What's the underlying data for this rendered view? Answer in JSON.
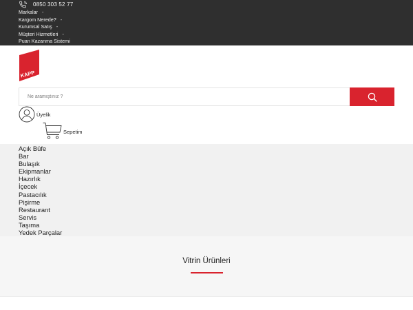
{
  "topbar": {
    "phone": "0850 303 52 77",
    "links": [
      {
        "label": "Markalar",
        "sep": "-"
      },
      {
        "label": "Kargom Nerede?",
        "sep": "-"
      },
      {
        "label": "Kurumsal Satış",
        "sep": "-"
      },
      {
        "label": "Müşteri Hizmetleri",
        "sep": "-"
      },
      {
        "label": "Puan Kazanma Sistemi",
        "sep": ""
      }
    ]
  },
  "brand": {
    "logo_text": "KAPP",
    "color": "#d9232e"
  },
  "search": {
    "placeholder": "Ne aramıştınız ?",
    "value": "",
    "icon": "search-icon"
  },
  "account": {
    "label": "Üyelik",
    "icon": "user-icon"
  },
  "cart": {
    "label": "Sepetim",
    "icon": "cart-icon"
  },
  "categories": [
    "Açık Büfe",
    "Bar",
    "Bulaşık",
    "Ekipmanlar",
    "Hazırlık",
    "İçecek",
    "Pastacılık",
    "Pişirme",
    "Restaurant",
    "Servis",
    "Taşıma",
    "Yedek Parçalar"
  ],
  "showcase": {
    "title": "Vitrin Ürünleri"
  },
  "colors": {
    "topbar": "#2f2f2f",
    "accent": "#d9232e",
    "band": "#f1f1f1"
  }
}
